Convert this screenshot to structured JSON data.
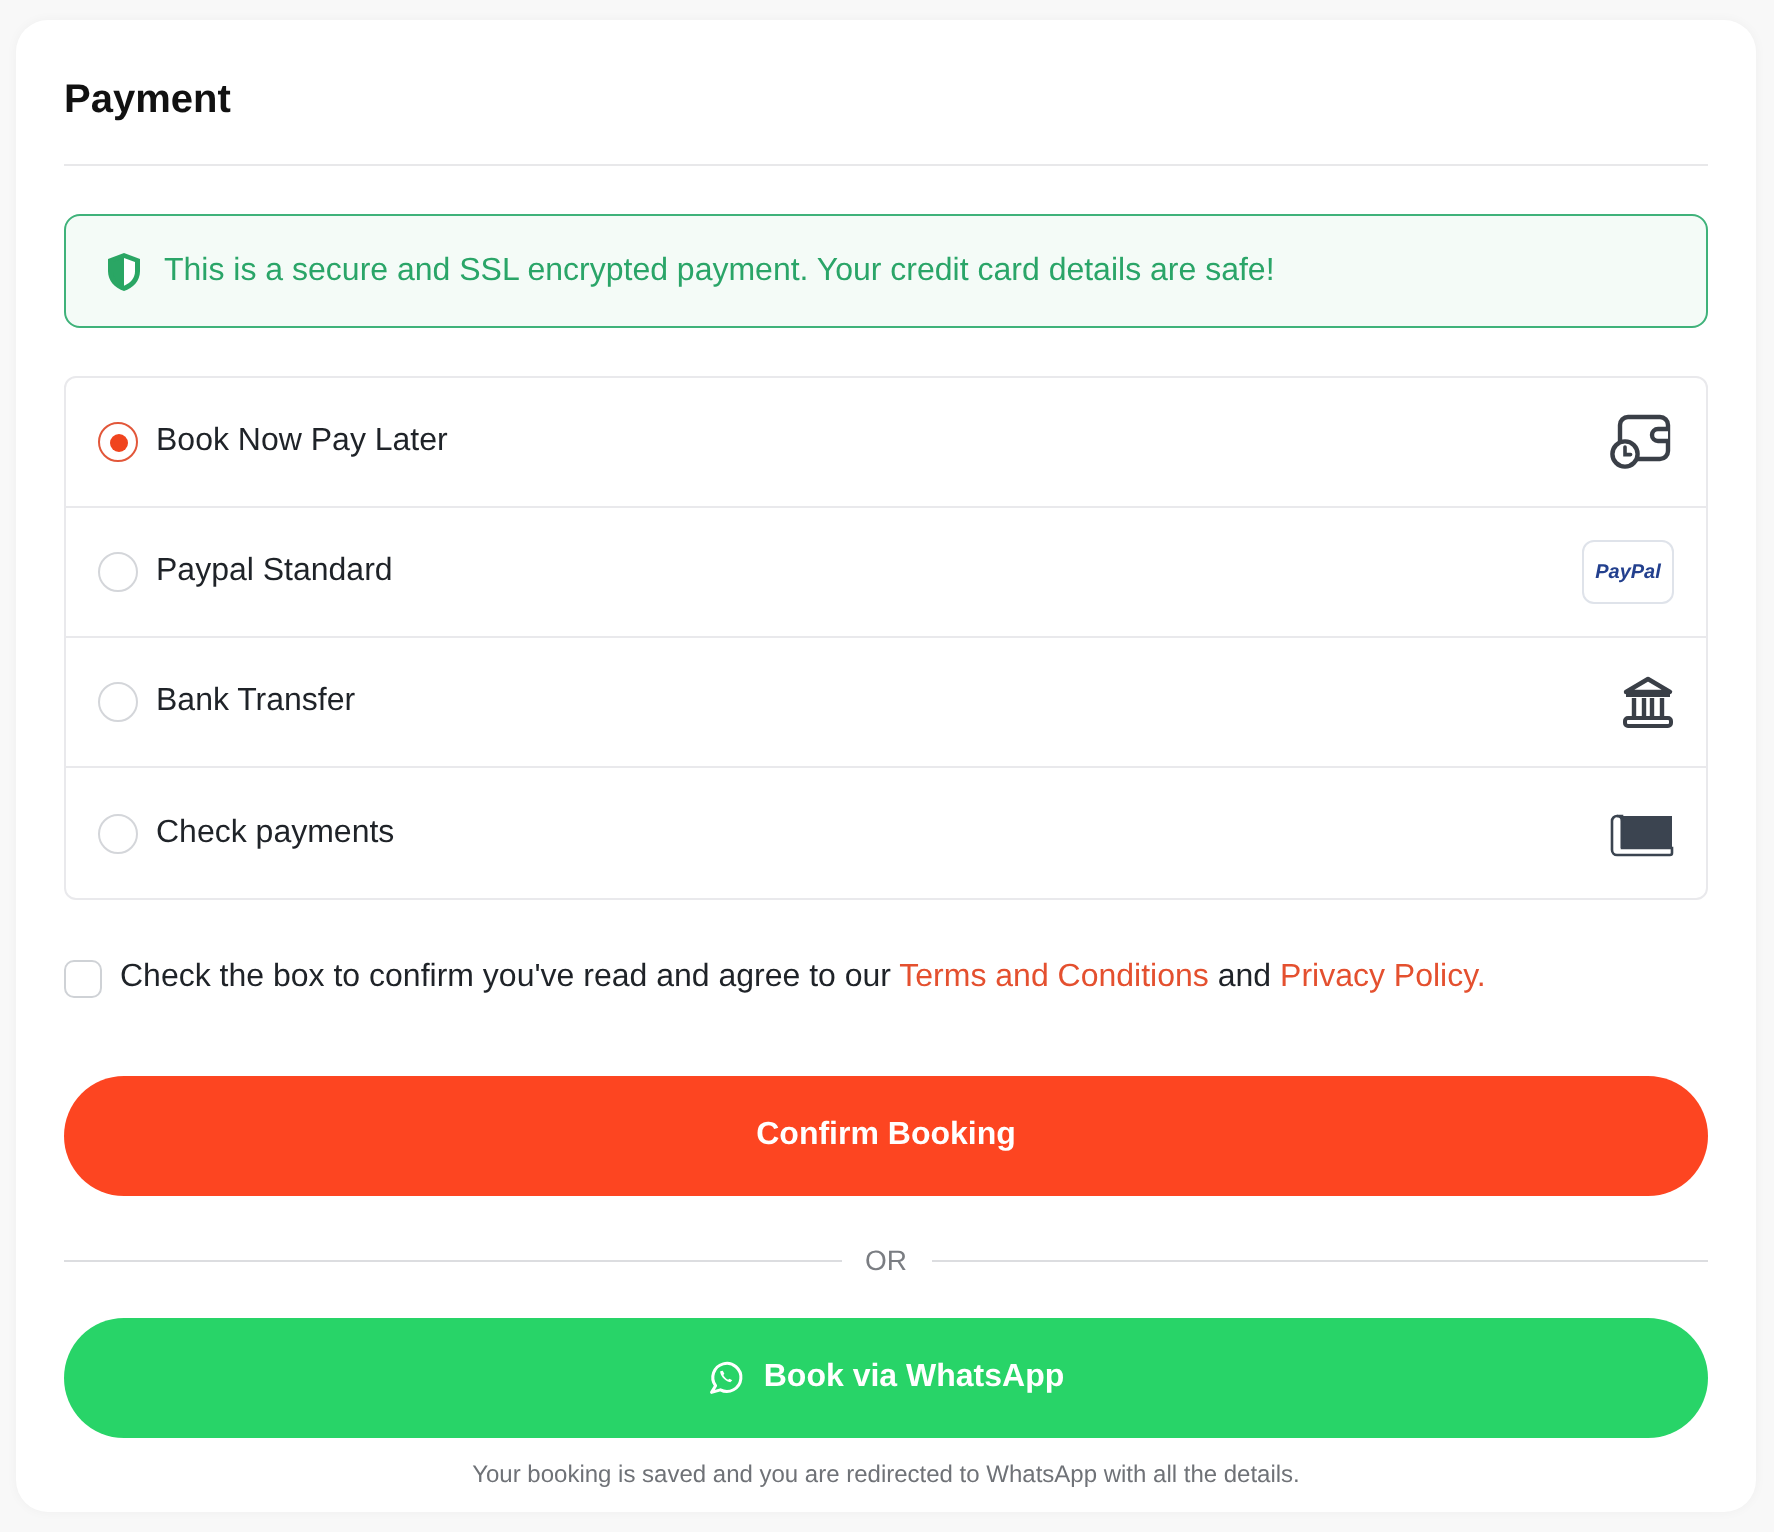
{
  "title": "Payment",
  "secure_notice": {
    "text": "This is a secure and SSL encrypted payment. Your credit card details are safe!"
  },
  "payment_methods": [
    {
      "label": "Book Now Pay Later",
      "selected": true,
      "kind": "pay_later"
    },
    {
      "label": "Paypal Standard",
      "selected": false,
      "kind": "paypal",
      "badge": "PayPal"
    },
    {
      "label": "Bank Transfer",
      "selected": false,
      "kind": "bank"
    },
    {
      "label": "Check payments",
      "selected": false,
      "kind": "check"
    }
  ],
  "agreement": {
    "checked": false,
    "parts": [
      {
        "kind": "text",
        "text": "Check the box to confirm you've read and agree to our"
      },
      {
        "kind": "link",
        "text": "Terms and Conditions"
      },
      {
        "kind": "text",
        "text": "and"
      },
      {
        "kind": "link",
        "text": "Privacy Policy."
      }
    ]
  },
  "confirm_button": "Confirm Booking",
  "divider_text": "OR",
  "whatsapp_button": "Book via WhatsApp",
  "whatsapp_note": "Your booking is saved and you are redirected to WhatsApp with all the details."
}
